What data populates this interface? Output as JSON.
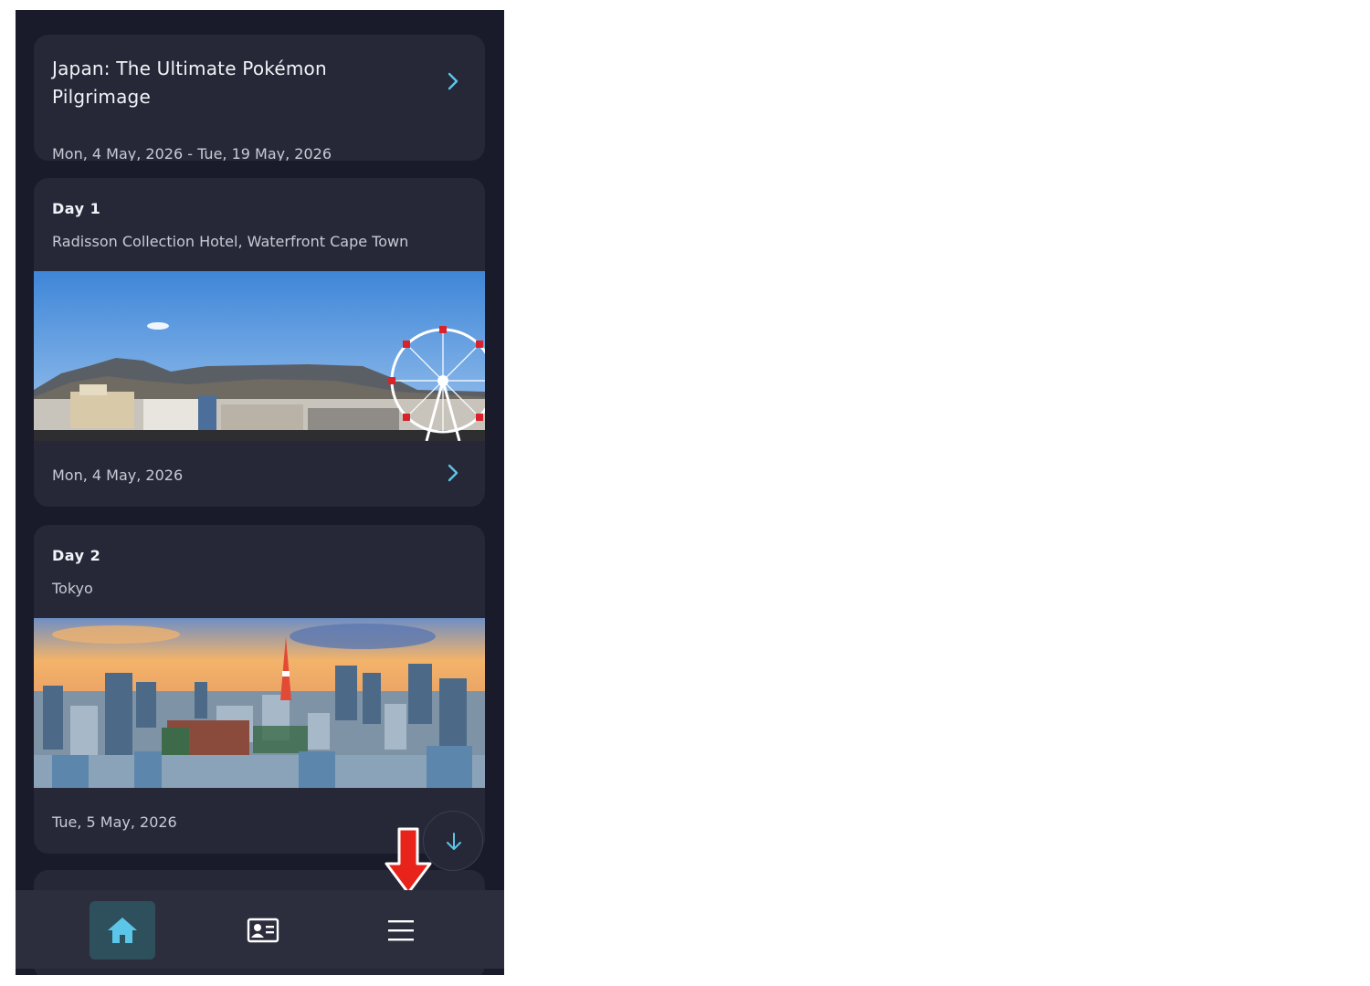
{
  "trip": {
    "title": "Japan: The Ultimate Pokémon Pilgrimage",
    "dates": "Mon, 4 May, 2026 - Tue, 19 May, 2026"
  },
  "days": [
    {
      "label": "Day  1",
      "place": "Radisson Collection Hotel, Waterfront Cape Town",
      "date": "Mon, 4 May, 2026",
      "image": "cape-town-table-mountain-ferris-wheel"
    },
    {
      "label": "Day  2",
      "place": "Tokyo",
      "date": "Tue, 5 May, 2026",
      "image": "tokyo-skyline-tokyo-tower"
    }
  ],
  "nav": {
    "items": [
      {
        "name": "home",
        "icon": "home-icon",
        "active": true
      },
      {
        "name": "profile",
        "icon": "id-card-icon",
        "active": false
      },
      {
        "name": "menu",
        "icon": "hamburger-menu-icon",
        "active": false
      }
    ]
  },
  "colors": {
    "background": "#1a1b2a",
    "card": "#262837",
    "accent": "#5cc6e8",
    "nav_active": "#2e4f5c",
    "annotation_arrow": "#e8231b"
  }
}
